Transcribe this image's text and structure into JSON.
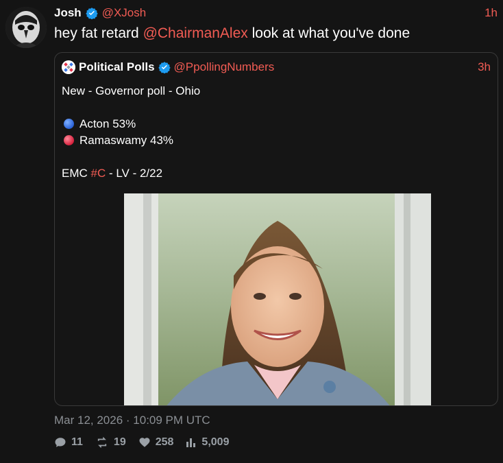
{
  "tweet": {
    "author_name": "Josh",
    "author_handle": "@XJosh",
    "time_ago": "1h",
    "text_prefix": "hey fat retard ",
    "mention": "@ChairmanAlex",
    "text_suffix": " look at what you've done"
  },
  "quote": {
    "author_name": "Political Polls",
    "author_handle": "@PpollingNumbers",
    "time_ago": "3h",
    "headline": "New - Governor poll - Ohio",
    "results": [
      {
        "name": "Acton",
        "pct": "53%",
        "color": "#3b78e7"
      },
      {
        "name": "Ramaswamy",
        "pct": "43%",
        "color": "#e5334b"
      }
    ],
    "source_prefix": "EMC ",
    "source_hashtag": "#C",
    "source_suffix": " - LV - 2/22"
  },
  "meta": {
    "timestamp": "Mar 12, 2026 · 10:09 PM UTC"
  },
  "stats": {
    "replies": "11",
    "reposts": "19",
    "likes": "258",
    "views": "5,009"
  },
  "colors": {
    "accent": "#f25c54",
    "verified": "#1d9bf0",
    "background": "#141414"
  }
}
